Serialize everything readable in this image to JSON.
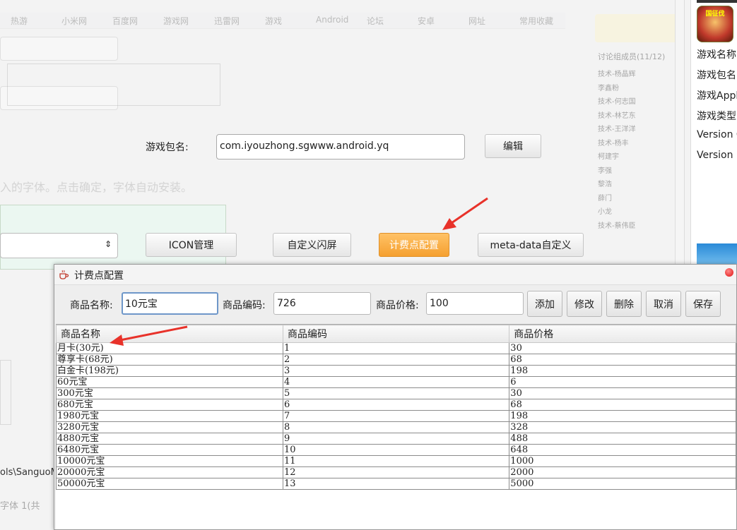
{
  "background": {
    "bookmarks": [
      "热游",
      "小米网",
      "百度网",
      "游戏网",
      "迅雷网",
      "游戏",
      "Android",
      "论坛",
      "安卓",
      "网址",
      "常用收藏"
    ],
    "pkg_label": "游戏包名:",
    "pkg_value": "com.iyouzhong.sgwww.android.yq",
    "edit_btn": "编辑",
    "install_hint": "入的字体。点击确定，字体自动安装。",
    "buttons": {
      "icon": "ICON管理",
      "splash": "自定义闪屏",
      "billing": "计费点配置",
      "meta": "meta-data自定义"
    },
    "path_fragment": "ols\\SanguoM",
    "font_count": "字体 1(共",
    "right_panel": [
      "游戏名称",
      "游戏包名",
      "游戏Appl",
      "游戏类型",
      "Version C",
      "Version N"
    ],
    "game_icon_text": "国征伐",
    "chat_header": "讨论组成员(11/12)",
    "chat_members": [
      "技术-杨晶辉",
      "李鑫粉",
      "技术-何志国",
      "技术-林艺东",
      "技术-王洋洋",
      "技术-杨丰",
      "柯建宇",
      "李强",
      "黎浩",
      "薛门",
      "小龙",
      "技术-蔡伟臣"
    ]
  },
  "dialog": {
    "title": "计费点配置",
    "form": {
      "name_label": "商品名称:",
      "name_value": "10元宝",
      "code_label": "商品编码:",
      "code_value": "726",
      "price_label": "商品价格:",
      "price_value": "100"
    },
    "actions": {
      "add": "添加",
      "modify": "修改",
      "delete": "删除",
      "cancel": "取消",
      "save": "保存"
    },
    "table": {
      "headers": [
        "商品名称",
        "商品编码",
        "商品价格"
      ],
      "rows": [
        [
          "月卡(30元)",
          "1",
          "30"
        ],
        [
          "尊享卡(68元)",
          "2",
          "68"
        ],
        [
          "白金卡(198元)",
          "3",
          "198"
        ],
        [
          "60元宝",
          "4",
          "6"
        ],
        [
          "300元宝",
          "5",
          "30"
        ],
        [
          "680元宝",
          "6",
          "68"
        ],
        [
          "1980元宝",
          "7",
          "198"
        ],
        [
          "3280元宝",
          "8",
          "328"
        ],
        [
          "4880元宝",
          "9",
          "488"
        ],
        [
          "6480元宝",
          "10",
          "648"
        ],
        [
          "10000元宝",
          "11",
          "1000"
        ],
        [
          "20000元宝",
          "12",
          "2000"
        ],
        [
          "50000元宝",
          "13",
          "5000"
        ]
      ]
    }
  },
  "colors": {
    "accent_orange": "#f5a030",
    "arrow_red": "#e8322a",
    "close_red": "#e01010",
    "focus_blue": "#6e97c9"
  }
}
